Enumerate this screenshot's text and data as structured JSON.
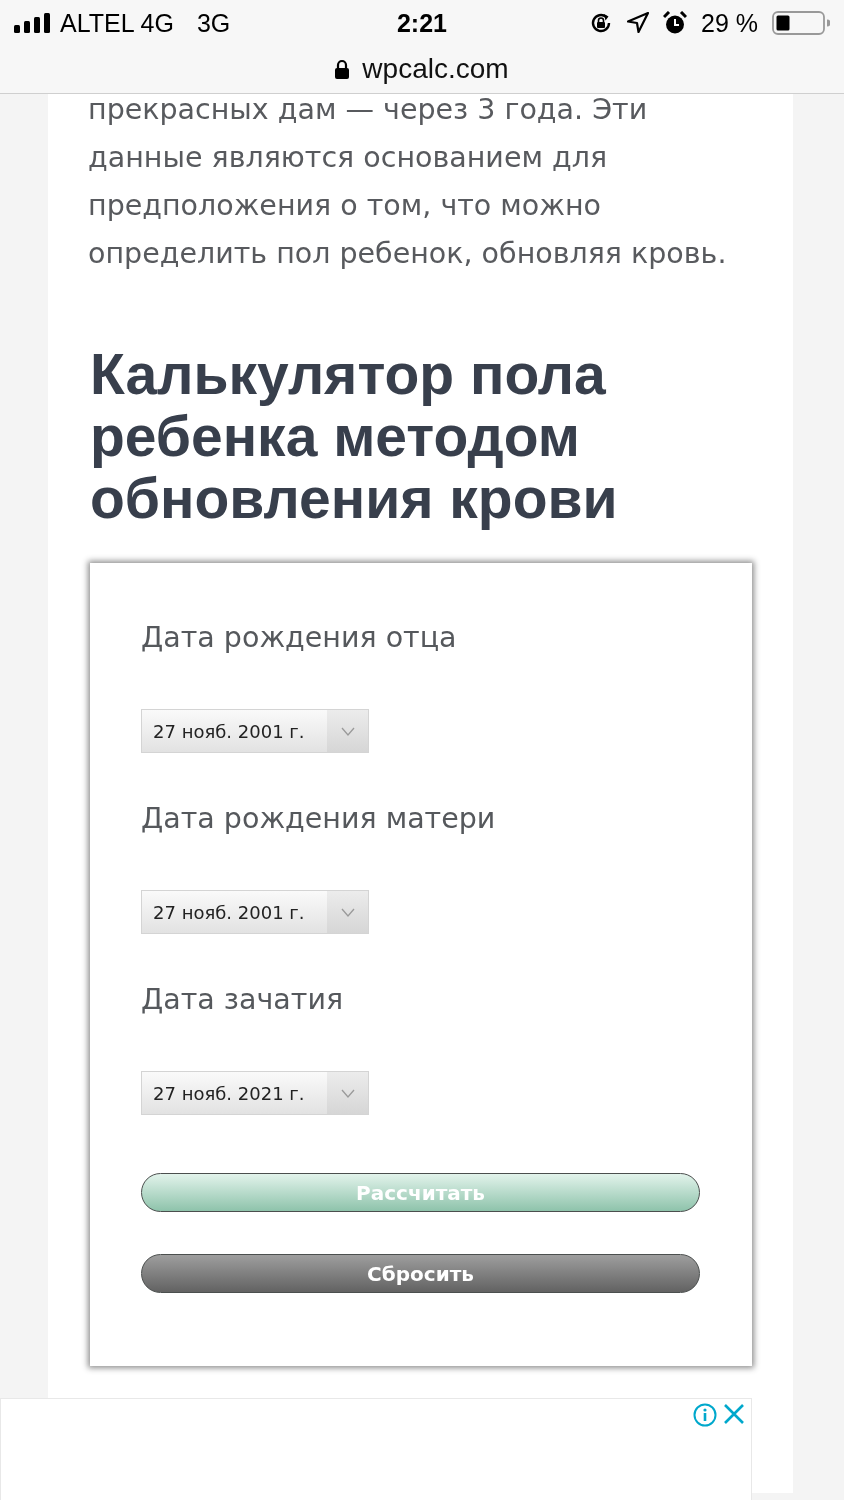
{
  "status_bar": {
    "carrier": "ALTEL 4G",
    "network": "3G",
    "time": "2:21",
    "battery": "29 %"
  },
  "address_bar": {
    "url": "wpcalc.com"
  },
  "article": {
    "paragraph": "прекрасных дам — через 3 года. Эти данные являются основанием для предположения о том, что можно определить пол ребенок, обновляя кровь.",
    "heading": "Калькулятор пола ребенка методом обновления крови"
  },
  "calculator": {
    "fields": [
      {
        "label": "Дата рождения отца",
        "value": "27 нояб. 2001 г."
      },
      {
        "label": "Дата рождения матери",
        "value": "27 нояб. 2001 г."
      },
      {
        "label": "Дата зачатия",
        "value": "27 нояб. 2021 г."
      }
    ],
    "buttons": [
      {
        "label": "Рассчитать",
        "kind": "primary"
      },
      {
        "label": "Сбросить",
        "kind": "secondary"
      }
    ]
  }
}
